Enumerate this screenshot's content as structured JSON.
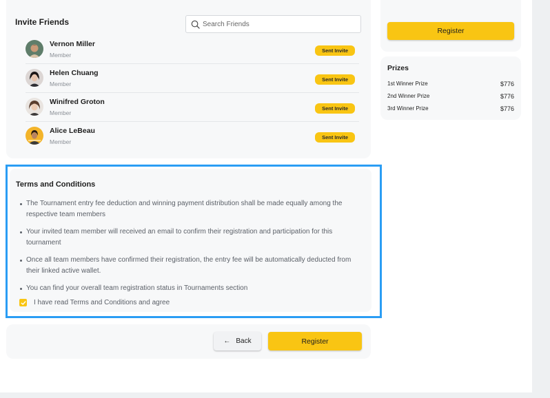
{
  "invite": {
    "title": "Invite Friends",
    "search_placeholder": "Search Friends",
    "friends": [
      {
        "name": "Vernon Miller",
        "role": "Member",
        "status": "Sent Invite"
      },
      {
        "name": "Helen Chuang",
        "role": "Member",
        "status": "Sent Invite"
      },
      {
        "name": "Winifred Groton",
        "role": "Member",
        "status": "Sent Invite"
      },
      {
        "name": "Alice LeBeau",
        "role": "Member",
        "status": "Sent Invite"
      }
    ]
  },
  "terms": {
    "title": "Terms and Conditions",
    "items": [
      "The Tournament entry fee deduction and winning payment distribution shall be made equally among the respective team members",
      "Your invited team member will received an email to confirm their registration and participation for this tournament",
      "Once all team members have confirmed their registration, the entry fee will be automatically deducted from their linked active wallet.",
      "You can find your overall team registration status in Tournaments section"
    ],
    "agree_label": "I have read Terms and Conditions and agree",
    "agree_checked": true
  },
  "actions": {
    "back_label": "Back",
    "register_label": "Register"
  },
  "sidebar": {
    "register_label": "Register",
    "prizes": {
      "title": "Prizes",
      "rows": [
        {
          "label": "1st Winner Prize",
          "amount": "$776"
        },
        {
          "label": "2nd Winner Prize",
          "amount": "$776"
        },
        {
          "label": "3rd Winner Prize",
          "amount": "$776"
        }
      ]
    }
  },
  "colors": {
    "accent": "#f9c513",
    "highlight_border": "#2a9df4",
    "card_bg": "#f7f8f9"
  }
}
